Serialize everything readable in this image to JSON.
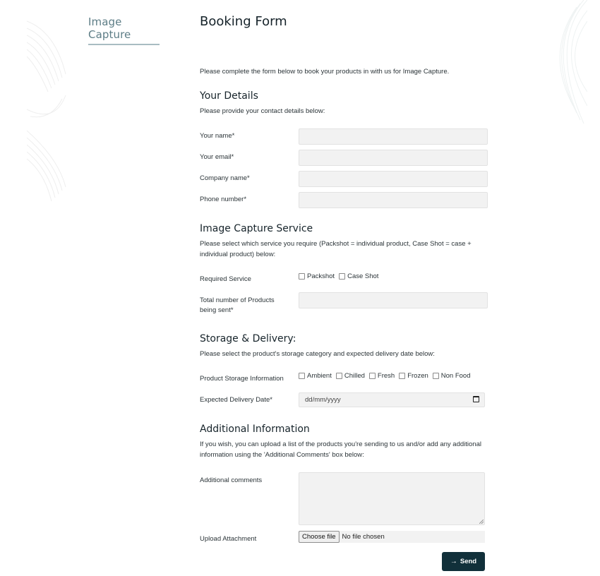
{
  "sidebar": {
    "title": "Image Capture"
  },
  "header": {
    "title": "Booking Form"
  },
  "intro": "Please complete the form below to book your products in with us for Image Capture.",
  "sections": {
    "details": {
      "title": "Your Details",
      "description": "Please provide your contact details below:",
      "fields": [
        {
          "label": "Your name*",
          "value": ""
        },
        {
          "label": "Your email*",
          "value": ""
        },
        {
          "label": "Company name*",
          "value": ""
        },
        {
          "label": "Phone number*",
          "value": ""
        }
      ]
    },
    "service": {
      "title": "Image Capture Service",
      "description": "Please select which service you require (Packshot = individual product, Case Shot = case + individual product) below:",
      "required_label": "Required Service",
      "options": [
        {
          "label": "Packshot",
          "checked": false
        },
        {
          "label": "Case Shot",
          "checked": false
        }
      ],
      "total_label": "Total number of Products being sent*",
      "total_value": ""
    },
    "storage": {
      "title": "Storage & Delivery:",
      "description": "Please select the product's storage category and expected delivery date below:",
      "storage_label": "Product Storage Information",
      "options": [
        {
          "label": "Ambient",
          "checked": false
        },
        {
          "label": "Chilled",
          "checked": false
        },
        {
          "label": "Fresh",
          "checked": false
        },
        {
          "label": "Frozen",
          "checked": false
        },
        {
          "label": "Non Food",
          "checked": false
        }
      ],
      "date_label": "Expected Delivery Date*",
      "date_placeholder": "dd/mm/yyyy"
    },
    "additional": {
      "title": "Additional Information",
      "description": "If you wish, you can upload a list of the products you're sending to us and/or add any additional information using the 'Additional Comments' box below:",
      "comments_label": "Additional comments",
      "comments_value": "",
      "upload_label": "Upload Attachment",
      "choose_file": "Choose file",
      "file_status": "No file chosen"
    }
  },
  "submit": {
    "label": "Send",
    "icon": "arrow-right-icon"
  },
  "colors": {
    "accent": "#11303a",
    "sidebar_title": "#5d7d86",
    "field_bg": "#f2f2f2"
  }
}
